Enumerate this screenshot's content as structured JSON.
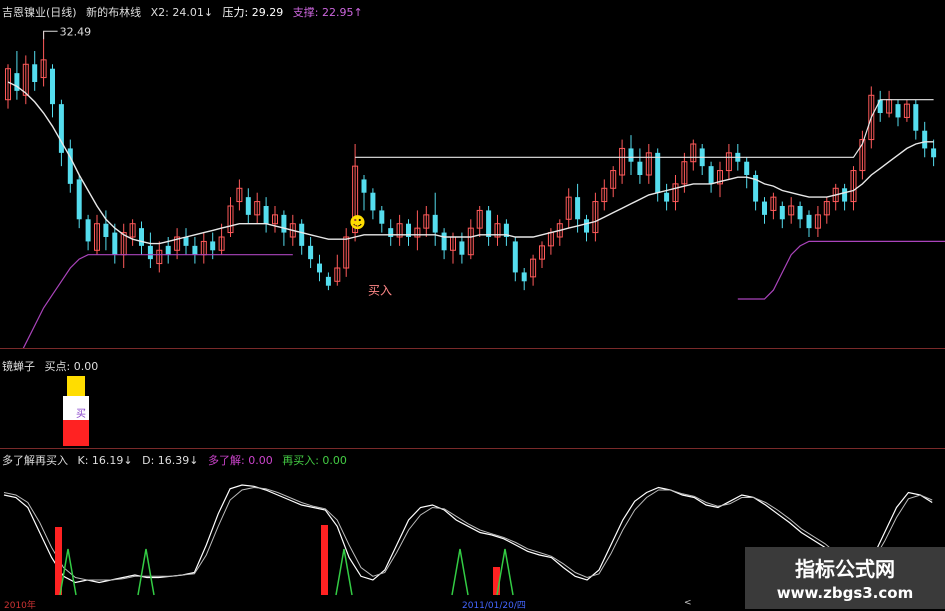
{
  "main_legend": {
    "title": "吉恩镍业(日线)",
    "indicator": "新的布林线",
    "x2": "X2: 24.01↓",
    "pressure": "压力: 29.29",
    "support": "支撑: 22.95↑"
  },
  "annotations": {
    "peak_price": "32.49",
    "buy_label": "买入",
    "smiley": "☻"
  },
  "mid_legend": {
    "name": "镜蝉子",
    "buy_point": "买点: 0.00"
  },
  "mid_bar_text": "买",
  "low_legend": {
    "name": "多了解再买入",
    "k": "K: 16.19↓",
    "d": "D: 16.39↓",
    "more": "多了解: 0.00",
    "rebuy": "再买入: 0.00"
  },
  "x_axis": {
    "label_start": "2010年",
    "label_mid": "2011/01/20/四",
    "label_end": "<"
  },
  "watermark": {
    "title": "指标公式网",
    "url": "www.zbgs3.com"
  },
  "colors": {
    "up": "#ff5a5a",
    "down": "#55ddee",
    "white_line": "#e8e8e8",
    "purple": "#aa44bb",
    "green_tri": "#33cc44",
    "red_bar": "#ff2222",
    "yellow": "#ffdd00"
  },
  "chart_data": {
    "type": "candlestick",
    "candles_note": "",
    "candles": [
      [
        29.4,
        30.8,
        29.0,
        31.0
      ],
      [
        30.6,
        29.8,
        29.4,
        31.6
      ],
      [
        29.6,
        31.0,
        29.2,
        31.4
      ],
      [
        31.0,
        30.2,
        29.8,
        31.6
      ],
      [
        30.4,
        31.2,
        30.0,
        32.49
      ],
      [
        30.8,
        29.2,
        28.6,
        31.0
      ],
      [
        29.2,
        27.0,
        26.4,
        29.4
      ],
      [
        27.2,
        25.6,
        25.2,
        27.6
      ],
      [
        25.8,
        24.0,
        23.6,
        26.0
      ],
      [
        24.0,
        23.0,
        22.6,
        24.2
      ],
      [
        22.6,
        23.8,
        22.4,
        24.2
      ],
      [
        23.8,
        23.2,
        22.6,
        24.4
      ],
      [
        23.4,
        22.4,
        22.0,
        23.8
      ],
      [
        22.4,
        23.4,
        21.8,
        23.8
      ],
      [
        23.2,
        23.8,
        22.8,
        24.0
      ],
      [
        23.6,
        22.8,
        22.4,
        23.9
      ],
      [
        22.8,
        22.2,
        21.8,
        23.4
      ],
      [
        22.0,
        22.6,
        21.6,
        23.0
      ],
      [
        22.8,
        22.4,
        22.0,
        23.2
      ],
      [
        22.6,
        23.2,
        22.2,
        23.6
      ],
      [
        23.2,
        22.8,
        22.4,
        23.6
      ],
      [
        22.8,
        22.4,
        22.0,
        23.2
      ],
      [
        22.4,
        23.0,
        22.0,
        23.4
      ],
      [
        23.0,
        22.6,
        22.2,
        23.4
      ],
      [
        22.6,
        23.2,
        22.4,
        23.8
      ],
      [
        23.4,
        24.6,
        23.2,
        25.0
      ],
      [
        24.8,
        25.4,
        24.4,
        25.8
      ],
      [
        25.0,
        24.2,
        23.8,
        25.4
      ],
      [
        24.2,
        24.8,
        23.8,
        25.2
      ],
      [
        24.6,
        23.8,
        23.4,
        25.0
      ],
      [
        23.8,
        24.2,
        23.4,
        24.6
      ],
      [
        24.2,
        23.4,
        22.8,
        24.4
      ],
      [
        23.2,
        23.8,
        22.8,
        24.2
      ],
      [
        23.8,
        22.8,
        22.4,
        24.0
      ],
      [
        22.8,
        22.2,
        21.8,
        23.2
      ],
      [
        22.0,
        21.6,
        21.2,
        22.4
      ],
      [
        21.4,
        21.0,
        20.8,
        21.6
      ],
      [
        21.2,
        21.8,
        21.0,
        22.4
      ],
      [
        21.8,
        23.2,
        21.4,
        23.6
      ],
      [
        23.4,
        26.4,
        23.0,
        27.4
      ],
      [
        25.8,
        25.2,
        24.4,
        26.0
      ],
      [
        25.2,
        24.4,
        24.0,
        25.4
      ],
      [
        24.4,
        23.8,
        23.4,
        24.6
      ],
      [
        23.6,
        23.2,
        22.8,
        24.0
      ],
      [
        23.2,
        23.8,
        22.8,
        24.2
      ],
      [
        23.8,
        23.2,
        22.8,
        24.0
      ],
      [
        23.2,
        23.6,
        22.6,
        24.4
      ],
      [
        23.6,
        24.2,
        23.2,
        24.6
      ],
      [
        24.2,
        23.4,
        22.8,
        25.2
      ],
      [
        23.4,
        22.6,
        22.2,
        23.6
      ],
      [
        22.6,
        23.2,
        22.0,
        23.4
      ],
      [
        23.0,
        22.4,
        22.0,
        23.4
      ],
      [
        22.4,
        23.6,
        22.2,
        24.0
      ],
      [
        23.6,
        24.4,
        23.2,
        24.6
      ],
      [
        24.4,
        23.2,
        22.8,
        24.6
      ],
      [
        23.2,
        23.8,
        22.8,
        24.2
      ],
      [
        23.8,
        23.2,
        22.8,
        24.0
      ],
      [
        23.0,
        21.6,
        21.2,
        23.2
      ],
      [
        21.6,
        21.2,
        20.8,
        21.8
      ],
      [
        21.4,
        22.2,
        21.0,
        22.4
      ],
      [
        22.2,
        22.8,
        21.8,
        23.0
      ],
      [
        22.8,
        23.4,
        22.4,
        23.6
      ],
      [
        23.2,
        23.8,
        22.8,
        24.0
      ],
      [
        24.0,
        25.0,
        23.6,
        25.4
      ],
      [
        25.0,
        24.0,
        23.4,
        25.6
      ],
      [
        24.0,
        23.4,
        23.0,
        24.2
      ],
      [
        23.4,
        24.8,
        23.0,
        25.2
      ],
      [
        24.8,
        25.4,
        24.4,
        25.8
      ],
      [
        25.4,
        26.2,
        25.0,
        26.4
      ],
      [
        26.0,
        27.2,
        25.6,
        27.6
      ],
      [
        27.2,
        26.6,
        26.0,
        27.8
      ],
      [
        26.6,
        26.0,
        25.6,
        27.2
      ],
      [
        26.0,
        27.0,
        25.6,
        27.4
      ],
      [
        27.0,
        25.2,
        24.8,
        27.2
      ],
      [
        25.2,
        24.8,
        24.4,
        25.6
      ],
      [
        24.8,
        25.6,
        24.4,
        26.0
      ],
      [
        25.6,
        26.6,
        25.2,
        27.0
      ],
      [
        26.6,
        27.4,
        26.2,
        27.6
      ],
      [
        27.2,
        26.4,
        26.0,
        27.4
      ],
      [
        26.4,
        25.6,
        25.2,
        26.6
      ],
      [
        25.6,
        26.2,
        25.0,
        26.6
      ],
      [
        26.2,
        27.0,
        25.8,
        27.4
      ],
      [
        27.0,
        26.6,
        26.2,
        27.4
      ],
      [
        26.6,
        26.0,
        25.4,
        26.8
      ],
      [
        26.0,
        24.8,
        24.4,
        26.2
      ],
      [
        24.8,
        24.2,
        23.8,
        25.0
      ],
      [
        24.4,
        25.0,
        24.0,
        25.2
      ],
      [
        24.6,
        24.0,
        23.6,
        24.8
      ],
      [
        24.2,
        24.6,
        23.8,
        25.0
      ],
      [
        24.6,
        24.0,
        23.6,
        24.8
      ],
      [
        24.2,
        23.6,
        23.2,
        24.4
      ],
      [
        23.6,
        24.2,
        23.2,
        24.6
      ],
      [
        24.2,
        24.8,
        23.8,
        25.0
      ],
      [
        24.8,
        25.4,
        24.4,
        25.6
      ],
      [
        25.4,
        24.8,
        24.4,
        25.6
      ],
      [
        24.8,
        26.2,
        24.4,
        26.4
      ],
      [
        26.2,
        27.6,
        25.8,
        28.0
      ],
      [
        27.6,
        29.6,
        27.2,
        30.0
      ],
      [
        29.4,
        28.8,
        28.4,
        29.8
      ],
      [
        28.8,
        29.4,
        28.6,
        29.8
      ],
      [
        29.2,
        28.6,
        28.2,
        29.4
      ],
      [
        28.6,
        29.2,
        28.4,
        29.4
      ],
      [
        29.2,
        28.0,
        27.6,
        29.4
      ],
      [
        28.0,
        27.2,
        26.8,
        28.4
      ],
      [
        27.2,
        26.8,
        26.4,
        27.6
      ]
    ],
    "series": [
      {
        "values": [
          30.2,
          30.0,
          29.7,
          29.3,
          28.8,
          28.2,
          27.5,
          26.8,
          26.0,
          25.3,
          24.6,
          24.0,
          23.6,
          23.3,
          23.1,
          23.0,
          22.9,
          22.9,
          23.0,
          23.1,
          23.2,
          23.3,
          23.4,
          23.5,
          23.6,
          23.7,
          23.8,
          23.8,
          23.8,
          23.8,
          23.7,
          23.6,
          23.5,
          23.4,
          23.3,
          23.2,
          23.1,
          23.1,
          23.1,
          23.2,
          23.3,
          23.3,
          23.3,
          23.3,
          23.3,
          23.3,
          23.3,
          23.3,
          23.3,
          23.2,
          23.2,
          23.2,
          23.2,
          23.3,
          23.3,
          23.3,
          23.3,
          23.2,
          23.2,
          23.2,
          23.3,
          23.4,
          23.5,
          23.6,
          23.7,
          23.8,
          23.9,
          24.1,
          24.3,
          24.5,
          24.7,
          24.9,
          25.1,
          25.2,
          25.3,
          25.4,
          25.5,
          25.6,
          25.6,
          25.6,
          25.7,
          25.8,
          25.9,
          25.9,
          25.8,
          25.6,
          25.5,
          25.3,
          25.2,
          25.1,
          25.0,
          25.0,
          25.0,
          25.1,
          25.2,
          25.3,
          25.6,
          26.0,
          26.3,
          26.6,
          26.9,
          27.2,
          27.4,
          27.5,
          27.5
        ]
      },
      {
        "values": [
          null,
          null,
          null,
          null,
          null,
          null,
          null,
          null,
          null,
          null,
          null,
          null,
          null,
          null,
          null,
          null,
          null,
          null,
          null,
          null,
          null,
          null,
          null,
          null,
          null,
          null,
          null,
          null,
          null,
          null,
          null,
          null,
          null,
          null,
          null,
          null,
          null,
          null,
          null,
          26.8,
          26.8,
          26.8,
          26.8,
          26.8,
          26.8,
          26.8,
          26.8,
          26.8,
          26.8,
          26.8,
          26.8,
          26.8,
          26.8,
          26.8,
          26.8,
          26.8,
          26.8,
          26.8,
          26.8,
          26.8,
          26.8,
          26.8,
          26.8,
          26.8,
          26.8,
          26.8,
          26.8,
          26.8,
          26.8,
          26.8,
          26.8,
          26.8,
          26.8,
          26.8,
          26.8,
          26.8,
          26.8,
          26.8,
          26.8,
          26.8,
          26.8,
          26.8,
          26.8,
          26.8,
          26.8,
          26.8,
          26.8,
          26.8,
          26.8,
          26.8,
          26.8,
          26.8,
          26.8,
          26.8,
          26.8,
          26.8,
          27.4,
          28.6,
          29.4,
          29.4,
          29.4,
          29.4,
          29.4,
          29.4,
          29.4
        ]
      },
      {
        "values": [
          17.0,
          17.6,
          18.4,
          19.2,
          20.0,
          20.6,
          21.2,
          21.8,
          22.2,
          22.4,
          22.4,
          22.4,
          22.4,
          22.4,
          22.4,
          22.4,
          22.4,
          22.4,
          22.4,
          22.4,
          22.4,
          22.4,
          22.4,
          22.4,
          22.4,
          22.4,
          22.4,
          22.4,
          22.4,
          22.4,
          22.4,
          22.4,
          22.4,
          null,
          null,
          null,
          null,
          null,
          null,
          null,
          null,
          null,
          null,
          null,
          null,
          null,
          null,
          null,
          null,
          null,
          null,
          null,
          null,
          null,
          null,
          null,
          null,
          null,
          null,
          null,
          null,
          null,
          null,
          null,
          null,
          null,
          null,
          null,
          null,
          null,
          null,
          null,
          null,
          null,
          null,
          null,
          null,
          null,
          null,
          null,
          null,
          null,
          20.4,
          20.4,
          20.4,
          20.4,
          20.8,
          21.6,
          22.4,
          22.8,
          23.0,
          23.0,
          23.0,
          23.0,
          23.0,
          23.0,
          23.0,
          23.0,
          23.0,
          23.0,
          23.0,
          23.0,
          23.0,
          23.0,
          23.0,
          23.0,
          23.0
        ]
      }
    ],
    "upper_band": [
      null,
      null,
      null,
      null,
      null,
      null,
      null,
      null,
      null,
      null,
      null,
      null,
      null,
      null,
      null,
      null,
      null,
      null,
      null,
      null,
      null,
      null,
      null,
      null,
      null,
      null,
      null,
      null,
      null,
      null,
      null,
      null,
      null,
      null,
      null,
      null,
      null,
      null,
      null,
      null,
      null,
      null,
      null,
      null,
      null,
      null,
      null,
      null,
      null,
      null,
      null,
      null,
      null,
      null,
      null,
      null,
      null,
      null,
      null,
      null,
      null,
      null,
      null,
      null,
      null,
      null,
      null,
      null,
      null,
      null,
      null,
      null,
      null,
      null,
      null,
      null,
      null,
      null,
      null,
      null,
      null,
      null,
      null,
      null,
      null,
      null,
      null,
      null,
      null,
      null,
      null,
      null,
      null,
      null,
      null,
      null,
      null,
      null,
      null,
      null,
      null,
      null,
      null,
      null,
      null
    ],
    "kd_k": [
      80,
      78,
      70,
      50,
      30,
      15,
      10,
      12,
      10,
      12,
      14,
      16,
      14,
      14,
      15,
      16,
      18,
      40,
      65,
      85,
      88,
      87,
      84,
      80,
      76,
      72,
      70,
      68,
      55,
      30,
      15,
      12,
      20,
      40,
      60,
      70,
      72,
      68,
      60,
      55,
      50,
      48,
      45,
      40,
      35,
      32,
      30,
      22,
      15,
      12,
      20,
      40,
      60,
      75,
      82,
      86,
      84,
      80,
      78,
      72,
      70,
      75,
      80,
      78,
      72,
      65,
      58,
      50,
      44,
      38,
      30,
      25,
      20,
      30,
      50,
      70,
      82,
      80,
      74
    ],
    "kd_d": [
      82,
      80,
      74,
      58,
      38,
      22,
      14,
      12,
      12,
      12,
      13,
      15,
      15,
      15,
      15,
      16,
      17,
      32,
      55,
      76,
      84,
      86,
      85,
      82,
      78,
      74,
      71,
      69,
      60,
      40,
      22,
      15,
      18,
      34,
      52,
      64,
      70,
      69,
      63,
      57,
      52,
      49,
      46,
      42,
      37,
      34,
      31,
      25,
      18,
      14,
      17,
      33,
      52,
      68,
      78,
      84,
      84,
      81,
      79,
      74,
      71,
      73,
      78,
      78,
      74,
      68,
      61,
      53,
      47,
      41,
      33,
      27,
      22,
      27,
      43,
      62,
      77,
      80,
      76
    ],
    "ylim": [
      19,
      33
    ]
  }
}
